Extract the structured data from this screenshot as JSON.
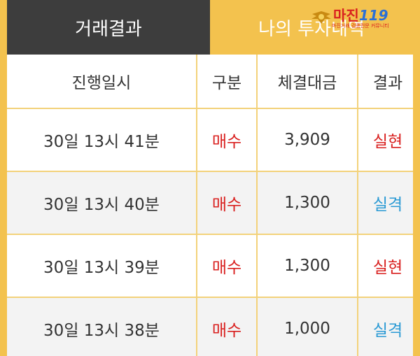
{
  "tabs": {
    "trade_results": "거래결과",
    "my_investments": "나의 투자내역"
  },
  "logo": {
    "name": "마진",
    "number": "119",
    "tagline": "마진거래 검증전문 커뮤니티"
  },
  "table": {
    "headers": [
      "진행일시",
      "구분",
      "체결대금",
      "결과"
    ],
    "rows": [
      {
        "datetime": "30일 13시 41분",
        "type": "매수",
        "amount": "3,909",
        "result": "실현"
      },
      {
        "datetime": "30일 13시 40분",
        "type": "매수",
        "amount": "1,300",
        "result": "실격"
      },
      {
        "datetime": "30일 13시 39분",
        "type": "매수",
        "amount": "1,300",
        "result": "실현"
      },
      {
        "datetime": "30일 13시 38분",
        "type": "매수",
        "amount": "1,000",
        "result": "실격"
      }
    ]
  },
  "colors": {
    "accent": "#f3c24e",
    "dark_tab": "#3d3d3d",
    "buy": "#d9201f",
    "success": "#d9201f",
    "fail": "#2a9ad4"
  },
  "icons": {
    "logo_emblem": "winged-emblem-icon"
  }
}
